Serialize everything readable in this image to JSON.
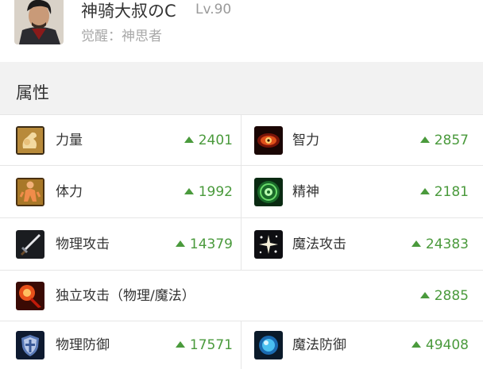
{
  "profile": {
    "name": "神骑大叔のC",
    "level": "Lv.90",
    "awakening": "觉醒：神思者"
  },
  "section": {
    "title": "属性"
  },
  "stats": [
    {
      "label": "力量",
      "value": "2401",
      "icon": "strength-icon"
    },
    {
      "label": "智力",
      "value": "2857",
      "icon": "intelligence-icon"
    },
    {
      "label": "体力",
      "value": "1992",
      "icon": "vitality-icon"
    },
    {
      "label": "精神",
      "value": "2181",
      "icon": "spirit-icon"
    },
    {
      "label": "物理攻击",
      "value": "14379",
      "icon": "physical-attack-icon"
    },
    {
      "label": "魔法攻击",
      "value": "24383",
      "icon": "magic-attack-icon"
    },
    {
      "label": "独立攻击（物理/魔法）",
      "value": "2885",
      "icon": "independent-attack-icon"
    },
    {
      "label": "物理防御",
      "value": "17571",
      "icon": "physical-defense-icon"
    },
    {
      "label": "魔法防御",
      "value": "49408",
      "icon": "magic-defense-icon"
    }
  ],
  "colors": {
    "increase": "#4a9a3c",
    "section_bg": "#f2f2f2"
  }
}
